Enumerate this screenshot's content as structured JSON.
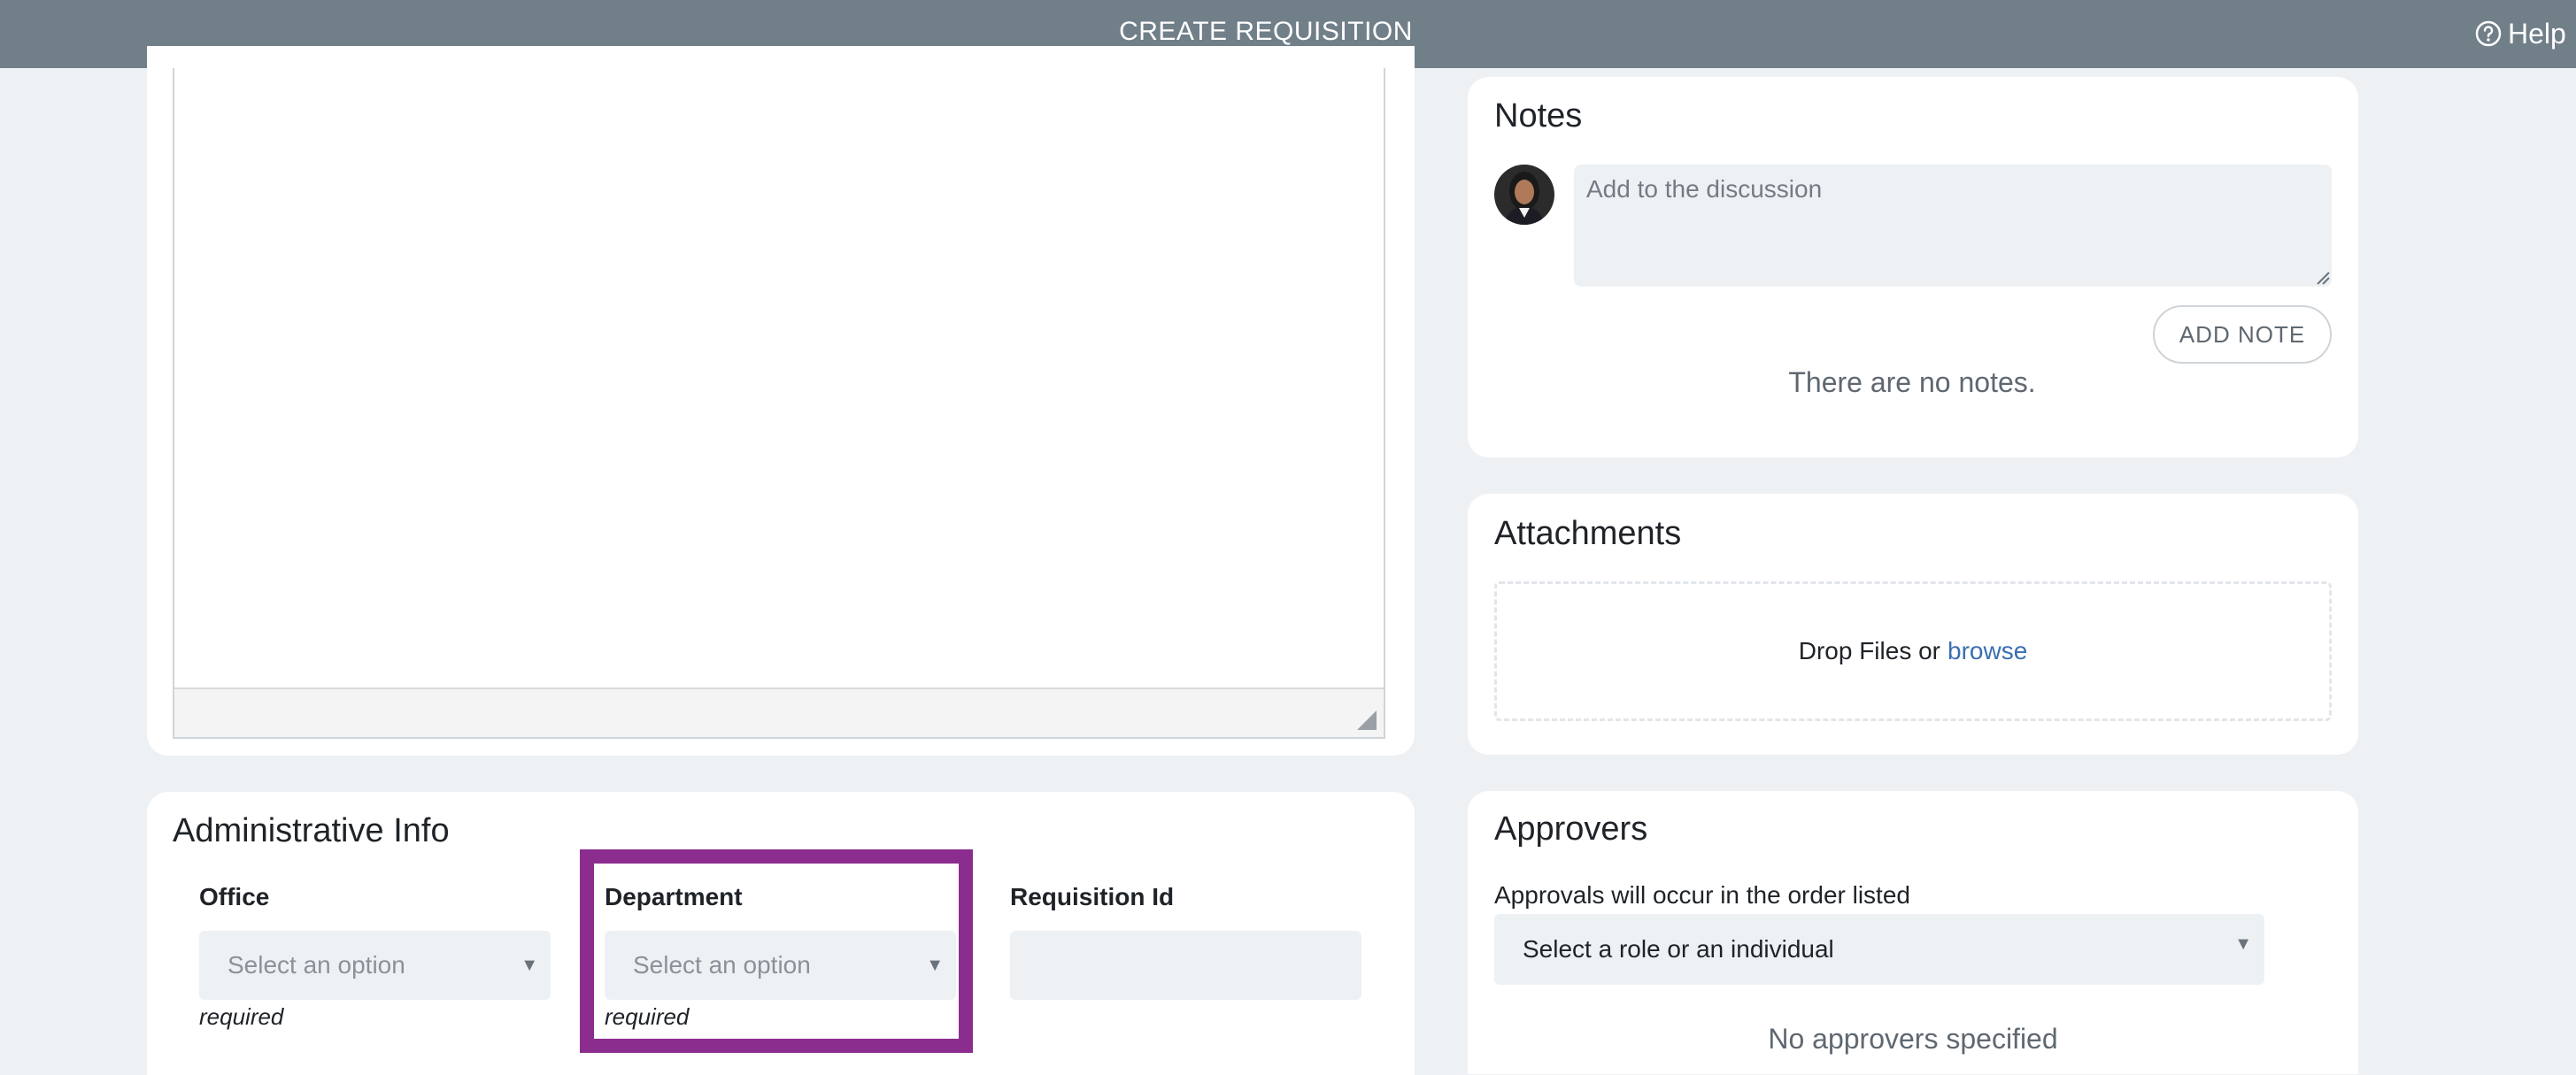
{
  "header": {
    "title": "CREATE REQUISITION",
    "help_label": "Help"
  },
  "notes": {
    "title": "Notes",
    "input_placeholder": "Add to the discussion",
    "add_button": "ADD NOTE",
    "empty_text": "There are no notes."
  },
  "attachments": {
    "title": "Attachments",
    "drop_text": "Drop Files or",
    "browse_link": "browse"
  },
  "admin_info": {
    "title": "Administrative Info",
    "office": {
      "label": "Office",
      "placeholder": "Select an option",
      "hint": "required"
    },
    "department": {
      "label": "Department",
      "placeholder": "Select an option",
      "hint": "required"
    },
    "requisition_id": {
      "label": "Requisition Id",
      "value": ""
    }
  },
  "approvers": {
    "title": "Approvers",
    "subtitle": "Approvals will occur in the order listed",
    "select_placeholder": "Select a role or an individual",
    "empty_text": "No approvers specified"
  },
  "colors": {
    "header_bg": "#717f89",
    "highlight": "#8b2d8e",
    "link": "#3a6fb0"
  },
  "icons": {
    "help": "question-circle-icon",
    "dropdown": "caret-down-icon",
    "resize": "resize-grip-icon"
  }
}
